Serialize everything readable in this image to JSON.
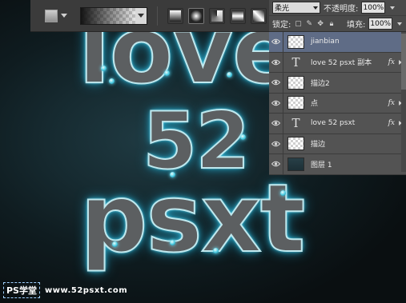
{
  "canvas": {
    "lines": [
      "love",
      "52",
      "psxt"
    ]
  },
  "options_bar": {
    "tool_icon": "gradient-tool-icon",
    "gradient_types": [
      "linear",
      "radial",
      "angle",
      "reflected",
      "diamond"
    ],
    "active_gradient_type": "radial"
  },
  "layers_panel": {
    "blend_mode": "柔光",
    "opacity_label": "不透明度:",
    "opacity_value": "100%",
    "lock_label": "锁定:",
    "fill_label": "填充:",
    "fill_value": "100%",
    "layers": [
      {
        "name": "jianbian",
        "type": "pixel",
        "selected": true,
        "fx": false
      },
      {
        "name": "love  52 psxt 副本",
        "type": "text",
        "selected": false,
        "fx": true
      },
      {
        "name": "描边2",
        "type": "pixel",
        "selected": false,
        "fx": false
      },
      {
        "name": "点",
        "type": "pixel",
        "selected": false,
        "fx": true
      },
      {
        "name": "love  52 psxt",
        "type": "text",
        "selected": false,
        "fx": true
      },
      {
        "name": "描边",
        "type": "pixel",
        "selected": false,
        "fx": false
      },
      {
        "name": "图层 1",
        "type": "filled",
        "selected": false,
        "fx": false
      }
    ],
    "text_thumb_glyph": "T",
    "fx_label": "fx"
  },
  "watermark": {
    "logo": "PS学堂",
    "url": "www.52psxt.com"
  },
  "colors": {
    "glow": "#6fe7ff",
    "letter_fill": "#5c5f61",
    "selected_layer": "#5f6c86"
  }
}
